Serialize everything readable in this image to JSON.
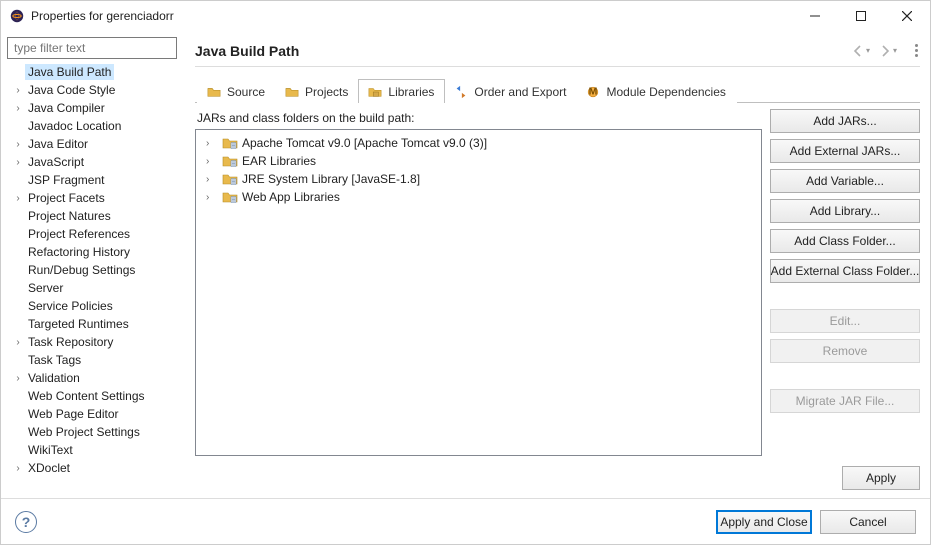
{
  "window": {
    "title": "Properties for gerenciadorr"
  },
  "filter": {
    "placeholder": "type filter text"
  },
  "sidebar": {
    "items": [
      {
        "label": "Java Build Path",
        "expandable": false,
        "selected": true
      },
      {
        "label": "Java Code Style",
        "expandable": true
      },
      {
        "label": "Java Compiler",
        "expandable": true
      },
      {
        "label": "Javadoc Location",
        "expandable": false
      },
      {
        "label": "Java Editor",
        "expandable": true
      },
      {
        "label": "JavaScript",
        "expandable": true
      },
      {
        "label": "JSP Fragment",
        "expandable": false
      },
      {
        "label": "Project Facets",
        "expandable": true
      },
      {
        "label": "Project Natures",
        "expandable": false
      },
      {
        "label": "Project References",
        "expandable": false
      },
      {
        "label": "Refactoring History",
        "expandable": false
      },
      {
        "label": "Run/Debug Settings",
        "expandable": false
      },
      {
        "label": "Server",
        "expandable": false
      },
      {
        "label": "Service Policies",
        "expandable": false
      },
      {
        "label": "Targeted Runtimes",
        "expandable": false
      },
      {
        "label": "Task Repository",
        "expandable": true
      },
      {
        "label": "Task Tags",
        "expandable": false
      },
      {
        "label": "Validation",
        "expandable": true
      },
      {
        "label": "Web Content Settings",
        "expandable": false
      },
      {
        "label": "Web Page Editor",
        "expandable": false
      },
      {
        "label": "Web Project Settings",
        "expandable": false
      },
      {
        "label": "WikiText",
        "expandable": false
      },
      {
        "label": "XDoclet",
        "expandable": true
      }
    ]
  },
  "page": {
    "title": "Java Build Path"
  },
  "tabs": [
    {
      "label": "Source",
      "active": false,
      "icon": "folder"
    },
    {
      "label": "Projects",
      "active": false,
      "icon": "folder"
    },
    {
      "label": "Libraries",
      "active": true,
      "icon": "jar"
    },
    {
      "label": "Order and Export",
      "active": false,
      "icon": "order"
    },
    {
      "label": "Module Dependencies",
      "active": false,
      "icon": "module"
    }
  ],
  "libs": {
    "description": "JARs and class folders on the build path:",
    "items": [
      {
        "label": "Apache Tomcat v9.0 [Apache Tomcat v9.0 (3)]"
      },
      {
        "label": "EAR Libraries"
      },
      {
        "label": "JRE System Library [JavaSE-1.8]"
      },
      {
        "label": "Web App Libraries"
      }
    ]
  },
  "buttons": {
    "addJars": "Add JARs...",
    "addExternalJars": "Add External JARs...",
    "addVariable": "Add Variable...",
    "addLibrary": "Add Library...",
    "addClassFolder": "Add Class Folder...",
    "addExternalClassFolder": "Add External Class Folder...",
    "edit": "Edit...",
    "remove": "Remove",
    "migrate": "Migrate JAR File...",
    "apply": "Apply",
    "applyClose": "Apply and Close",
    "cancel": "Cancel"
  }
}
